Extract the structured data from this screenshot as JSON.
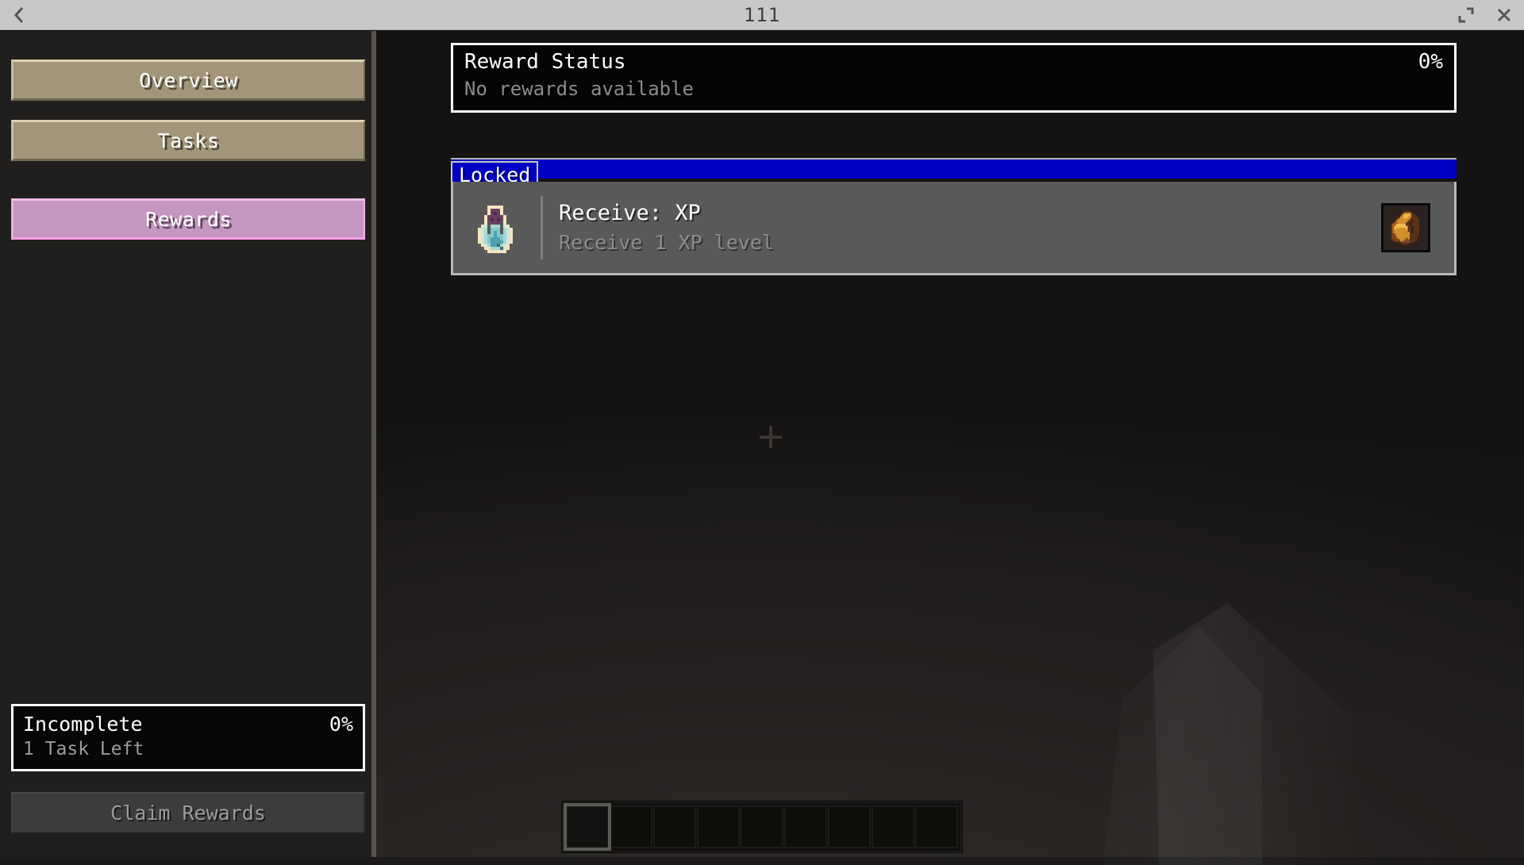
{
  "window": {
    "title": "111",
    "back_icon": "back-chevron-icon",
    "maximize_icon": "maximize-icon",
    "close_icon": "close-icon"
  },
  "sidebar": {
    "nav_items": [
      {
        "label": "Overview",
        "state": "inactive"
      },
      {
        "label": "Tasks",
        "state": "inactive"
      },
      {
        "label": "Rewards",
        "state": "active"
      }
    ],
    "status": {
      "title": "Incomplete",
      "percent": "0%",
      "subtitle": "1 Task Left"
    },
    "claim_button": {
      "label": "Claim Rewards",
      "enabled": false
    }
  },
  "content": {
    "reward_status": {
      "title": "Reward Status",
      "percent": "0%",
      "subtitle": "No rewards available"
    },
    "sections": [
      {
        "tag": "Locked",
        "tag_color": "#0000c4",
        "rewards": [
          {
            "title": "Receive: XP",
            "subtitle": "Receive 1 XP level",
            "left_icon": "potion-bottle-icon",
            "right_icon": "loot-bag-icon"
          }
        ]
      }
    ]
  },
  "hud": {
    "crosshair_icon": "crosshair-icon",
    "hotbar": {
      "slot_count": 9,
      "selected_index": 0,
      "slots": [
        "",
        "",
        "",
        "",
        "",
        "",
        "",
        "",
        ""
      ]
    }
  },
  "colors": {
    "nav_tan": "#a3957a",
    "nav_active_pink": "#c596bf",
    "locked_blue": "#0000c4",
    "row_gray": "#595959",
    "titlebar": "#c8c8c8"
  }
}
